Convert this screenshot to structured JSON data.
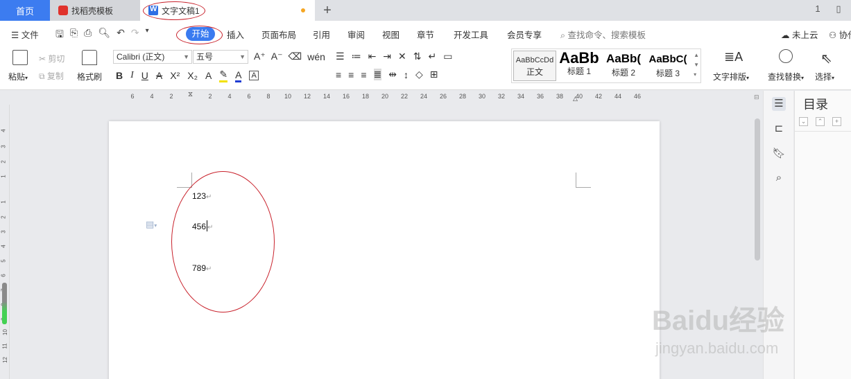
{
  "tabs": [
    {
      "label": "首页"
    },
    {
      "label": "找稻壳模板"
    },
    {
      "label": "文字文稿1"
    }
  ],
  "tab_add_label": "+",
  "window_buttons": [
    "1",
    "▯",
    "⊞"
  ],
  "menu": {
    "file_label": "文件",
    "items": [
      "开始",
      "插入",
      "页面布局",
      "引用",
      "审阅",
      "视图",
      "章节",
      "开发工具",
      "会员专享"
    ],
    "search_placeholder": "查找命令、搜索模板",
    "cloud_label": "未上云",
    "collab_label": "协作"
  },
  "ribbon": {
    "paste_label": "粘贴",
    "cut_label": "剪切",
    "copy_label": "复制",
    "format_painter_label": "格式刷",
    "font_name": "Calibri (正文)",
    "font_size": "五号",
    "styles": [
      {
        "sample": "AaBbCcDd",
        "name": "正文"
      },
      {
        "sample": "AaBb",
        "name": "标题 1"
      },
      {
        "sample": "AaBb(",
        "name": "标题 2"
      },
      {
        "sample": "AaBbC(",
        "name": "标题 3"
      }
    ],
    "text_layout_label": "文字排版",
    "find_replace_label": "查找替换",
    "select_label": "选择"
  },
  "ruler_ticks": [
    "6",
    "4",
    "2",
    "2",
    "4",
    "6",
    "8",
    "10",
    "12",
    "14",
    "16",
    "18",
    "20",
    "22",
    "24",
    "26",
    "28",
    "30",
    "32",
    "34",
    "36",
    "38",
    "40",
    "42",
    "44",
    "46"
  ],
  "vruler_ticks": [
    "4",
    "3",
    "2",
    "1",
    "1",
    "2",
    "3",
    "4",
    "5",
    "6",
    "7",
    "8",
    "9",
    "10",
    "11",
    "12"
  ],
  "document": {
    "paragraphs": [
      "123",
      "456",
      "789"
    ]
  },
  "toc": {
    "title": "目录"
  },
  "watermark": {
    "brand": "Baidu经验",
    "url": "jingyan.baidu.com"
  },
  "colors": {
    "accent": "#3a7bf0",
    "annotation": "#c8202a",
    "tab_active": "#3c7cf0"
  }
}
